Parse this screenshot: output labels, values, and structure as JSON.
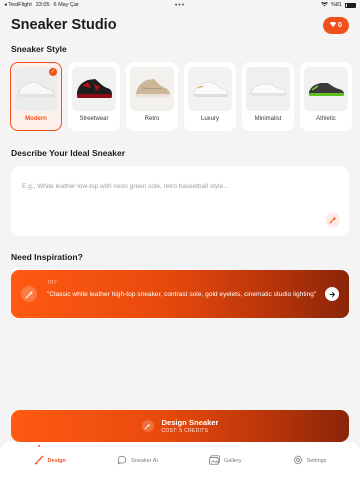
{
  "status": {
    "carrier": "TestFlight",
    "time": "23:05",
    "date": "6 May Çar",
    "dots": "•••",
    "battery": "%81"
  },
  "header": {
    "title": "Sneaker Studio",
    "credits": "0"
  },
  "styles_section": {
    "title": "Sneaker Style",
    "items": [
      {
        "label": "Modern",
        "selected": true,
        "shoe": "white-sneaker"
      },
      {
        "label": "Streetwear",
        "selected": false,
        "shoe": "black-red-sneaker"
      },
      {
        "label": "Retro",
        "selected": false,
        "shoe": "tan-sneaker"
      },
      {
        "label": "Luxury",
        "selected": false,
        "shoe": "white-gold-sneaker"
      },
      {
        "label": "Minimalist",
        "selected": false,
        "shoe": "white-minimal-sneaker"
      },
      {
        "label": "Athletic",
        "selected": false,
        "shoe": "black-green-sneaker"
      }
    ]
  },
  "describe": {
    "title": "Describe Your Ideal Sneaker",
    "value": "",
    "placeholder": "E.g., White leather low-top with neon green sole, retro basketball style..."
  },
  "inspiration": {
    "title": "Need Inspiration?",
    "label": "TRY",
    "text": "\"Classic white leather high-top sneaker, contrast sole, gold eyelets, cinematic studio lighting\""
  },
  "design_button": {
    "label": "Design Sneaker",
    "cost": "COST: 5 CREDITS"
  },
  "tabs": [
    {
      "label": "Design",
      "active": true,
      "icon": "brush-icon"
    },
    {
      "label": "Sneaker AI",
      "active": false,
      "icon": "chat-icon"
    },
    {
      "label": "Gallery",
      "active": false,
      "icon": "gallery-icon"
    },
    {
      "label": "Settings",
      "active": false,
      "icon": "gear-icon"
    }
  ],
  "colors": {
    "accent": "#f0511a",
    "accent_dark": "#8a2508",
    "background": "#f4f4f5"
  }
}
